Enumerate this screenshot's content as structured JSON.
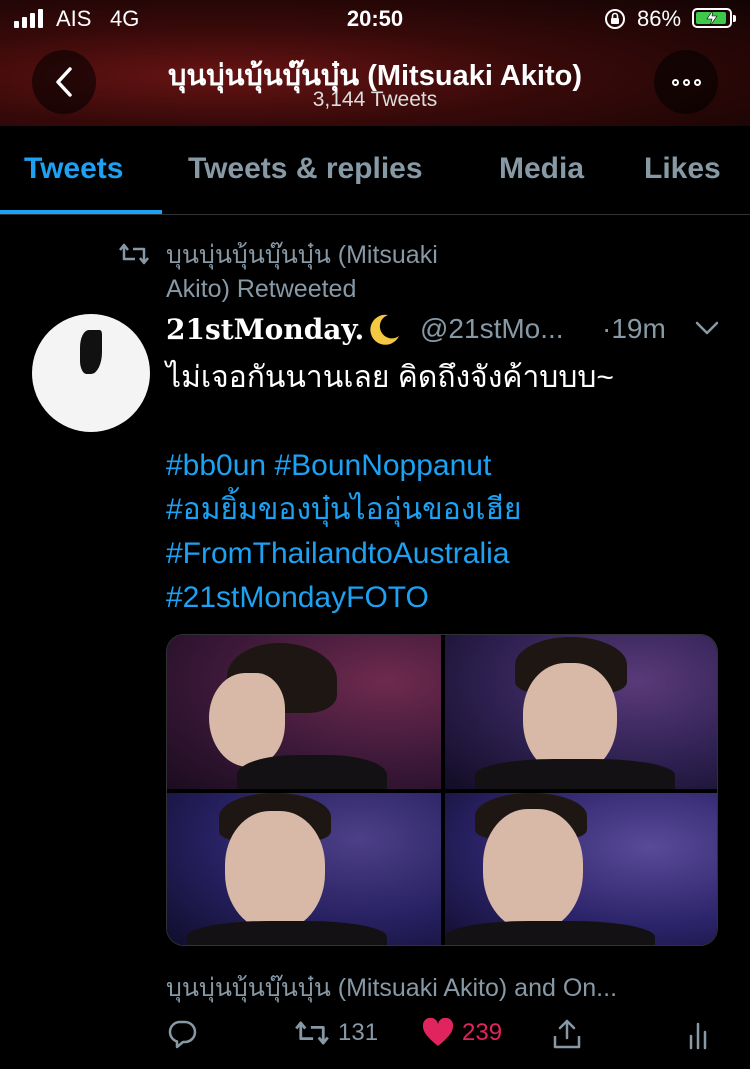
{
  "status_bar": {
    "carrier": "AIS",
    "network": "4G",
    "time": "20:50",
    "battery_percent": "86%",
    "icons": [
      "signal-icon",
      "orientation-lock-icon",
      "battery-charging-icon"
    ]
  },
  "header": {
    "title": "บุนบุ่นบุ้นบุ๊นบุ๋น (Mitsuaki Akito)",
    "subtitle": "3,144 Tweets",
    "back_icon": "chevron-left-icon",
    "more_icon": "more-dots-icon"
  },
  "tabs": [
    {
      "label": "Tweets",
      "active": true
    },
    {
      "label": "Tweets & replies",
      "active": false
    },
    {
      "label": "Media",
      "active": false
    },
    {
      "label": "Likes",
      "active": false
    }
  ],
  "tweet": {
    "retweet_line_1": "บุนบุ่นบุ้นบุ๊นบุ๋น (Mitsuaki",
    "retweet_line_2": "Akito) Retweeted",
    "author_name": "21stMonday.",
    "handle": "@21stMo...",
    "time": "·19m",
    "text": "ไม่เจอกันนานเลย คิดถึงจังค้าบบบ~",
    "hashtags": [
      "#bb0un #BounNoppanut",
      "#อมยิ้มของบุ๋นไออุ่นของเฮีย",
      "#FromThailandtoAustralia",
      "#21stMondayFOTO"
    ],
    "photo_count": 4,
    "liked_by": "บุนบุ่นบุ้นบุ๊นบุ๋น (Mitsuaki Akito) and On...",
    "actions": {
      "reply_count": "",
      "retweet_count": "131",
      "like_count": "239"
    }
  },
  "colors": {
    "accent": "#1da1f2",
    "like": "#e0245e",
    "muted": "#8899a6",
    "background": "#000000"
  }
}
